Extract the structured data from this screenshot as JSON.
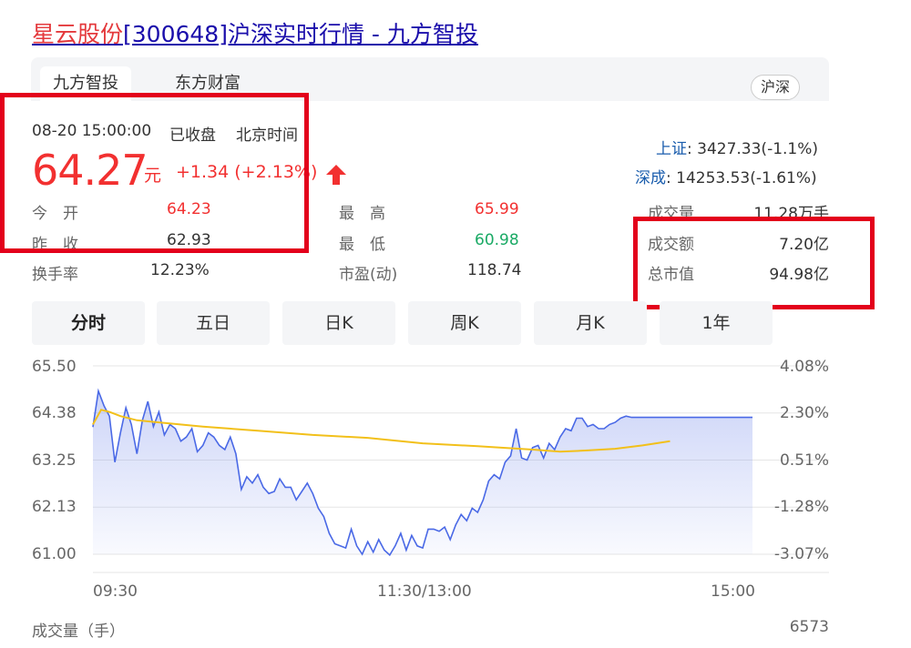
{
  "title": {
    "stock_name": "星云股份",
    "rest": "[300648]沪深实时行情 - 九方智投"
  },
  "tabs": [
    "九方智投",
    "东方财富"
  ],
  "market_badge": "沪深",
  "quote": {
    "datetime": "08-20 15:00:00",
    "status": "已收盘",
    "timezone": "北京时间",
    "price": "64.27",
    "unit": "元",
    "change": "+1.34 (+2.13%)"
  },
  "indices": [
    {
      "name": "上证",
      "value": ":  3427.33(-1.1%)"
    },
    {
      "name": "深成",
      "value": ":  14253.53(-1.61%)"
    }
  ],
  "stats": {
    "open_label": "今　开",
    "open": "64.23",
    "prev_label": "昨　收",
    "prev": "62.93",
    "turnover_label": "换手率",
    "turnover": "12.23%",
    "high_label": "最　高",
    "high": "65.99",
    "low_label": "最　低",
    "low": "60.98",
    "pe_label": "市盈(动)",
    "pe": "118.74",
    "vol_label": "成交量",
    "vol": "11.28万手",
    "amount_label": "成交额",
    "amount": "7.20亿",
    "mcap_label": "总市值",
    "mcap": "94.98亿"
  },
  "period_buttons": [
    "分时",
    "五日",
    "日K",
    "周K",
    "月K",
    "1年"
  ],
  "active_period": "分时",
  "volume_label": "成交量（手）",
  "volume_value": "6573",
  "colors": {
    "up": "#f23030",
    "down": "#1aaa65",
    "price_line": "#4a69e6",
    "avg_line": "#f2c01a",
    "highlight": "#e3001b"
  },
  "chart_data": {
    "type": "area",
    "title": "",
    "xlabel": "",
    "ylabel": "",
    "x_ticks": [
      "09:30",
      "11:30/13:00",
      "15:00"
    ],
    "y_ticks_left": [
      "65.50",
      "64.38",
      "63.25",
      "62.13",
      "61.00"
    ],
    "y_ticks_right": [
      "4.08%",
      "2.30%",
      "0.51%",
      "-1.28%",
      "-3.07%"
    ],
    "ylim": [
      61.0,
      65.5
    ],
    "xlim": [
      0,
      240
    ],
    "grid": true,
    "series": [
      {
        "name": "",
        "x": [
          0,
          2,
          4,
          6,
          8,
          10,
          12,
          14,
          16,
          18,
          20,
          22,
          24,
          26,
          28,
          30,
          32,
          34,
          36,
          38,
          40,
          42,
          44,
          46,
          48,
          50,
          52,
          54,
          56,
          58,
          60,
          62,
          64,
          66,
          68,
          70,
          72,
          74,
          76,
          78,
          80,
          82,
          84,
          86,
          88,
          90,
          92,
          94,
          96,
          98,
          100,
          102,
          104,
          106,
          108,
          110,
          112,
          114,
          116,
          118,
          120,
          122,
          124,
          126,
          128,
          130,
          132,
          134,
          136,
          138,
          140,
          142,
          144,
          146,
          148,
          150,
          152,
          154,
          156,
          158,
          160,
          162,
          164,
          166,
          168,
          170,
          172,
          174,
          176,
          178,
          180,
          182,
          184,
          186,
          188,
          190,
          192,
          194,
          196,
          198,
          200,
          202,
          204,
          206,
          208,
          210,
          212,
          214,
          216,
          218,
          220,
          222,
          224,
          226,
          228,
          230,
          232,
          234,
          236,
          238,
          240
        ],
        "values": [
          64.04,
          64.9,
          64.55,
          64.3,
          63.2,
          63.9,
          64.5,
          64.1,
          63.4,
          64.2,
          64.65,
          64.05,
          64.4,
          63.85,
          64.1,
          64.0,
          63.7,
          63.8,
          64.0,
          63.45,
          63.6,
          63.9,
          63.8,
          63.6,
          63.5,
          63.8,
          63.4,
          62.55,
          62.85,
          62.7,
          62.9,
          62.6,
          62.45,
          62.5,
          62.8,
          62.6,
          62.6,
          62.3,
          62.5,
          62.7,
          62.45,
          62.1,
          61.9,
          61.5,
          61.25,
          61.2,
          61.15,
          61.6,
          61.2,
          61.0,
          61.3,
          61.05,
          61.35,
          61.1,
          60.98,
          61.2,
          61.5,
          61.1,
          61.45,
          61.2,
          61.15,
          61.6,
          61.6,
          61.55,
          61.65,
          61.35,
          61.7,
          61.95,
          61.8,
          62.1,
          62.0,
          62.3,
          62.75,
          62.9,
          62.8,
          63.2,
          63.35,
          64.0,
          63.3,
          63.25,
          63.55,
          63.6,
          63.3,
          63.65,
          63.5,
          63.8,
          64.0,
          63.95,
          64.25,
          64.25,
          64.05,
          64.1,
          64.0,
          64.0,
          64.1,
          64.15,
          64.25,
          64.3,
          64.27,
          64.27,
          64.27,
          64.27,
          64.27,
          64.27,
          64.27,
          64.27,
          64.27,
          64.27,
          64.27,
          64.27,
          64.27,
          64.27,
          64.27,
          64.27,
          64.27,
          64.27,
          64.27,
          64.27,
          64.27,
          64.27,
          64.27
        ]
      },
      {
        "name": "",
        "x": [
          0,
          3,
          6,
          10,
          16,
          24,
          40,
          60,
          80,
          100,
          120,
          140,
          160,
          170,
          180,
          190,
          200,
          210
        ],
        "values": [
          64.1,
          64.45,
          64.4,
          64.3,
          64.2,
          64.15,
          64.05,
          63.95,
          63.85,
          63.78,
          63.65,
          63.58,
          63.5,
          63.45,
          63.48,
          63.52,
          63.6,
          63.7
        ]
      }
    ]
  }
}
